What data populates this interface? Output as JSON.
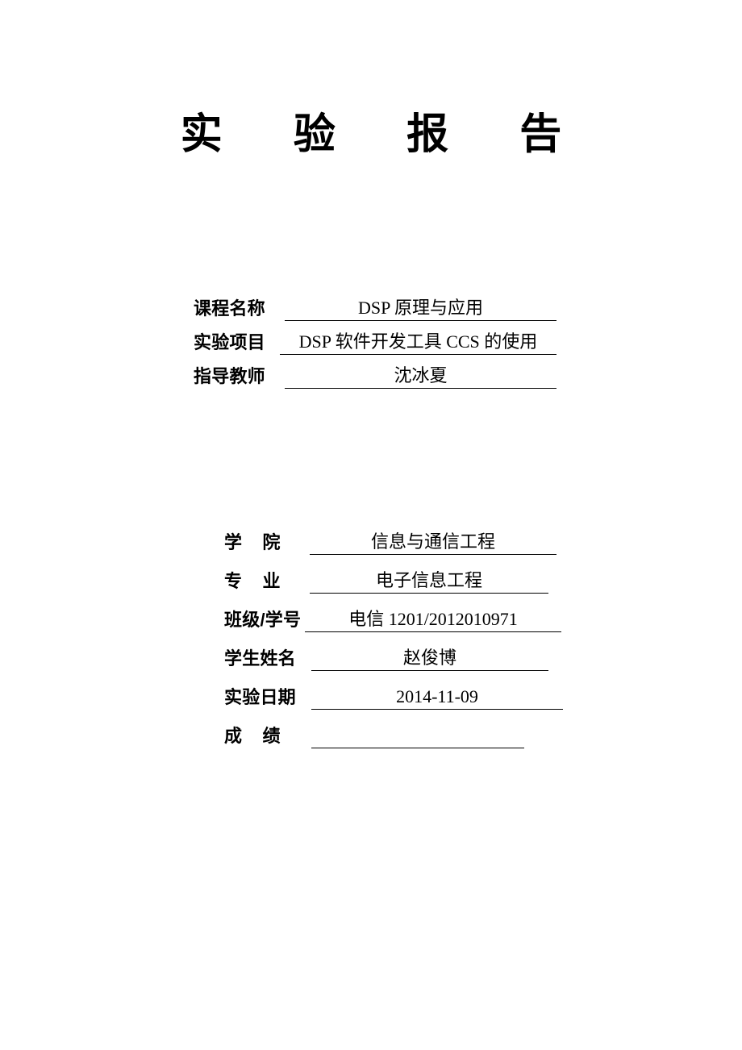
{
  "document": {
    "title": "实  验  报  告"
  },
  "course_block": {
    "rows": [
      {
        "label": "课程名称",
        "value": "DSP 原理与应用"
      },
      {
        "label": "实验项目",
        "value": "DSP 软件开发工具 CCS 的使用"
      },
      {
        "label": "指导教师",
        "value": "沈冰夏"
      }
    ]
  },
  "student_block": {
    "rows": [
      {
        "label": "学    院",
        "value": "信息与通信工程"
      },
      {
        "label": "专    业",
        "value": "电子信息工程"
      },
      {
        "label": "班级/学号",
        "value": "电信 1201/2012010971"
      },
      {
        "label": "学生姓名",
        "value": "赵俊博"
      },
      {
        "label": "实验日期",
        "value": "2014-11-09"
      },
      {
        "label": "成    绩",
        "value": ""
      }
    ]
  },
  "colors": {
    "page_background": "#ffffff",
    "text": "#000000",
    "rule": "#000000"
  }
}
